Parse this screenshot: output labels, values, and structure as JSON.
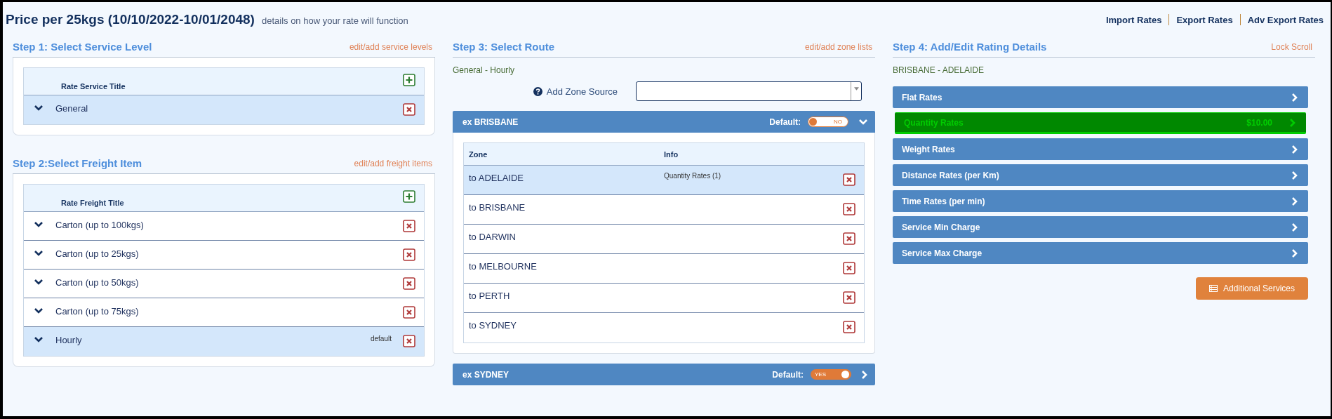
{
  "header": {
    "title": "Price per 25kgs (10/10/2022-10/01/2048)",
    "subtitle": "details on how your rate will function",
    "links": [
      "Import Rates",
      "Export Rates",
      "Adv Export Rates"
    ]
  },
  "step1": {
    "title": "Step 1: Select Service Level",
    "edit_link": "edit/add service levels",
    "column": "Rate Service Title",
    "rows": [
      {
        "label": "General",
        "selected": true
      }
    ]
  },
  "step2": {
    "title": "Step 2:Select Freight Item",
    "edit_link": "edit/add freight items",
    "column": "Rate Freight Title",
    "rows": [
      {
        "label": "Carton (up to 100kgs)",
        "selected": false
      },
      {
        "label": "Carton (up to 25kgs)",
        "selected": false
      },
      {
        "label": "Carton (up to 50kgs)",
        "selected": false
      },
      {
        "label": "Carton (up to 75kgs)",
        "selected": false
      },
      {
        "label": "Hourly",
        "selected": true,
        "badge": "default"
      }
    ]
  },
  "step3": {
    "title": "Step 3: Select Route",
    "edit_link": "edit/add zone lists",
    "route": "General - Hourly",
    "zone_source_label": "Add Zone Source",
    "groups": [
      {
        "title": "ex BRISBANE",
        "default_label": "Default:",
        "toggle_text": "NO",
        "on": false,
        "expanded": true,
        "columns": [
          "Zone",
          "Info"
        ],
        "zones": [
          {
            "zone": "to ADELAIDE",
            "info": "Quantity Rates (1)",
            "selected": true
          },
          {
            "zone": "to BRISBANE",
            "selected": false
          },
          {
            "zone": "to DARWIN",
            "selected": false
          },
          {
            "zone": "to MELBOURNE",
            "selected": false
          },
          {
            "zone": "to PERTH",
            "selected": false
          },
          {
            "zone": "to SYDNEY",
            "selected": false
          }
        ]
      },
      {
        "title": "ex SYDNEY",
        "default_label": "Default:",
        "toggle_text": "YES",
        "on": true,
        "expanded": false
      }
    ]
  },
  "step4": {
    "title": "Step 4: Add/Edit Rating Details",
    "lock_link": "Lock Scroll",
    "route": "BRISBANE - ADELAIDE",
    "rates": [
      {
        "label": "Flat Rates",
        "selected": false
      },
      {
        "label": "Quantity Rates",
        "value": "$10.00",
        "selected": true
      },
      {
        "label": "Weight Rates",
        "selected": false
      },
      {
        "label": "Distance Rates (per Km)",
        "selected": false
      },
      {
        "label": "Time Rates (per min)",
        "selected": false
      },
      {
        "label": "Service Min Charge",
        "selected": false
      },
      {
        "label": "Service Max Charge",
        "selected": false
      }
    ],
    "button": "Additional Services"
  }
}
